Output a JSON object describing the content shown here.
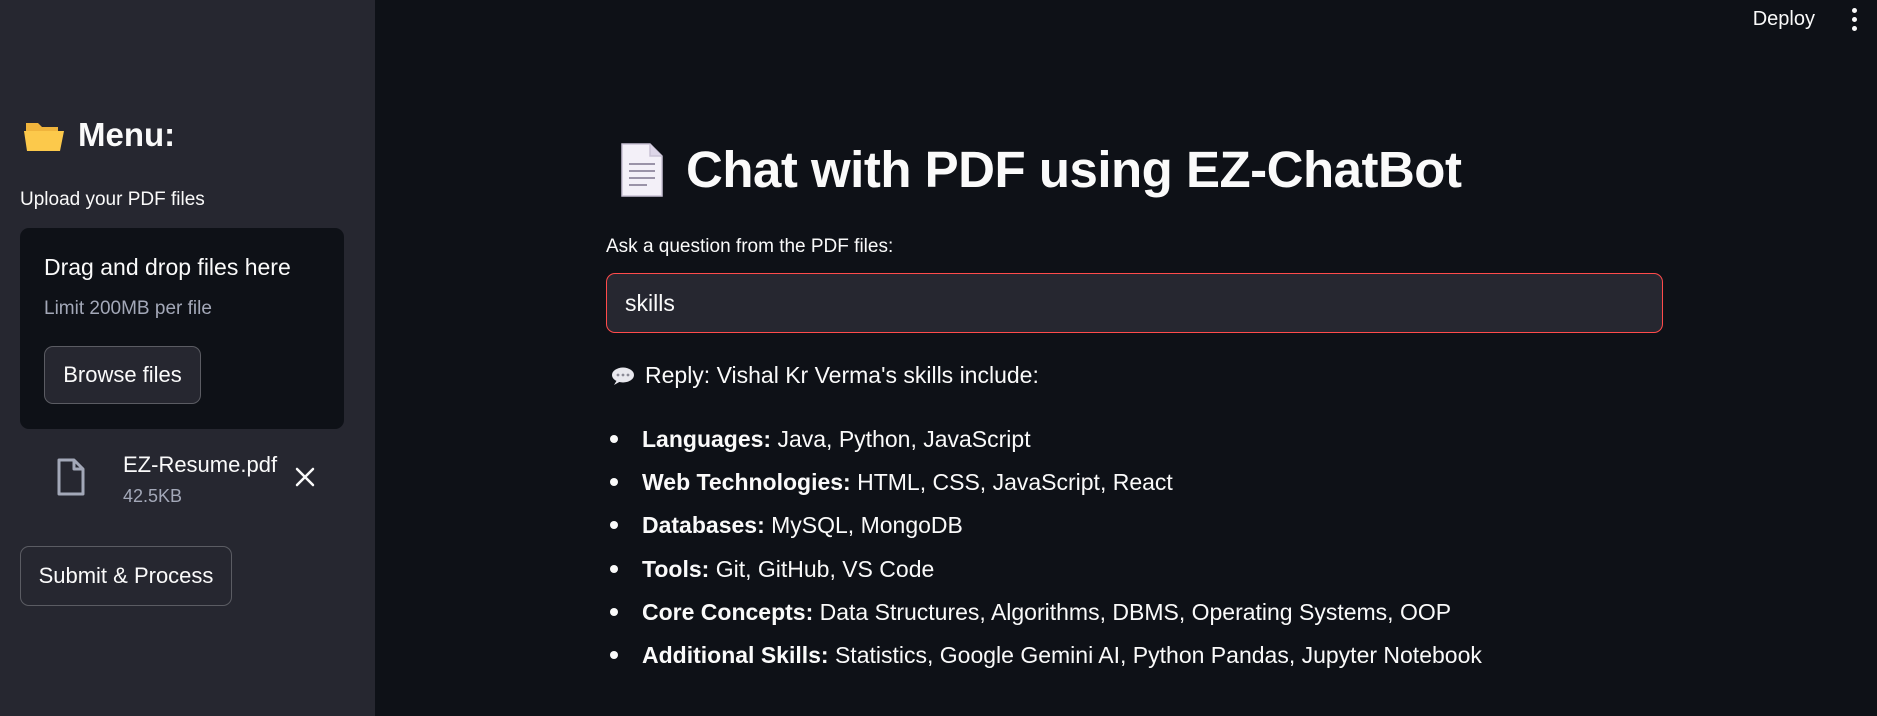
{
  "topbar": {
    "deploy_label": "Deploy",
    "more_icon": "kebab-menu-icon"
  },
  "sidebar": {
    "menu_icon": "open-folder-icon",
    "menu_title": "Menu:",
    "upload_label": "Upload your PDF files",
    "dropzone": {
      "title": "Drag and drop files here",
      "limit": "Limit 200MB per file",
      "browse_label": "Browse files"
    },
    "file": {
      "icon": "file-icon",
      "name": "EZ-Resume.pdf",
      "size": "42.5KB",
      "remove_icon": "close-icon"
    },
    "submit_label": "Submit & Process"
  },
  "main": {
    "title_icon": "document-icon",
    "title": "Chat with PDF using EZ-ChatBot",
    "question_label": "Ask a question from the PDF files:",
    "question_value": "skills",
    "reply_icon": "speech-bubble-icon",
    "reply": "Reply: Vishal Kr Verma's skills include:",
    "skills": [
      {
        "label": "Languages:",
        "value": "Java, Python, JavaScript"
      },
      {
        "label": "Web Technologies:",
        "value": "HTML, CSS, JavaScript, React"
      },
      {
        "label": "Databases:",
        "value": "MySQL, MongoDB"
      },
      {
        "label": "Tools:",
        "value": "Git, GitHub, VS Code"
      },
      {
        "label": "Core Concepts:",
        "value": "Data Structures, Algorithms, DBMS, Operating Systems, OOP"
      },
      {
        "label": "Additional Skills:",
        "value": "Statistics, Google Gemini AI, Python Pandas, Jupyter Notebook"
      }
    ]
  },
  "colors": {
    "background": "#0e1117",
    "sidebar": "#262730",
    "input_focus_border": "#ff4b4b",
    "text": "#fafafa",
    "muted_text": "#a3a8b8"
  }
}
